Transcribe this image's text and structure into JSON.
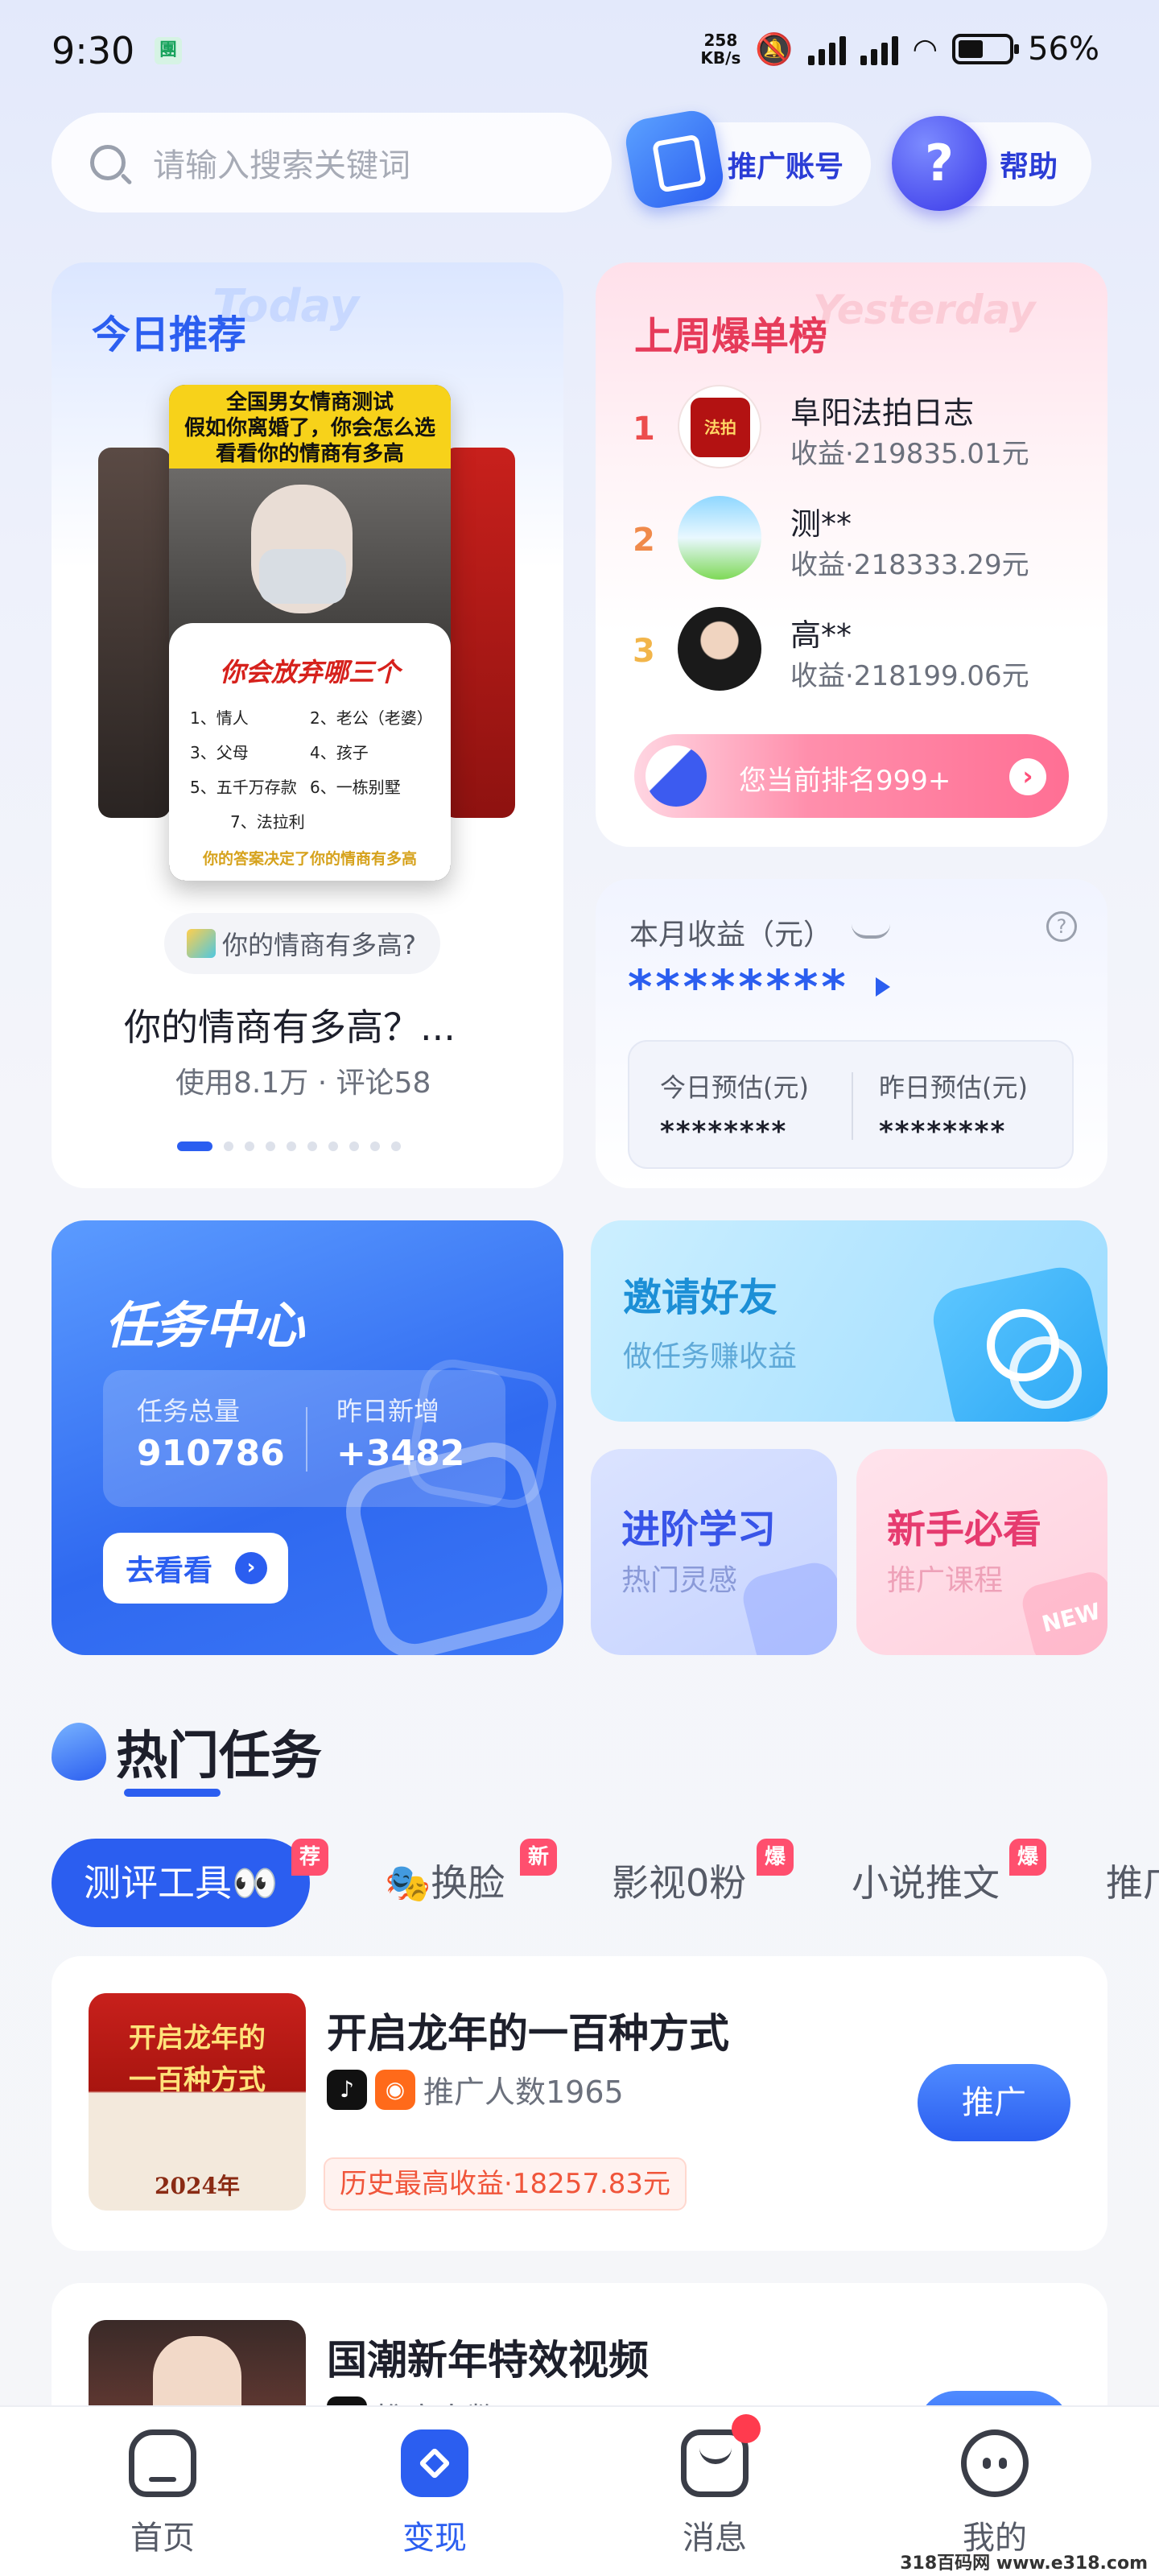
{
  "status_bar": {
    "time": "9:30",
    "app_badge": "團",
    "speed_top": "258",
    "speed_bottom": "KB/s",
    "battery": "56%"
  },
  "header": {
    "search_placeholder": "请输入搜索关键词",
    "promo_account": "推广账号",
    "help": "帮助"
  },
  "today": {
    "title": "今日推荐",
    "ghost": "Today",
    "poster_top": "全国男女情商测试\n假如你离婚了，你会怎么选\n看看你的情商有多高",
    "poster_question": "你会放弃哪三个",
    "poster_items": [
      "1、情人",
      "2、老公（老婆）",
      "3、父母",
      "4、孩子",
      "5、五千万存款",
      "6、一栋别墅",
      "7、法拉利",
      ""
    ],
    "poster_foot": "你的答案决定了你的情商有多高",
    "tag": "你的情商有多高?",
    "name": "你的情商有多高？...",
    "meta": "使用8.1万 · 评论58"
  },
  "weekly": {
    "title": "上周爆单榜",
    "ghost": "Yesterday",
    "ranks": [
      {
        "num": "1",
        "name": "阜阳法拍日志",
        "earn": "收益·219835.01元",
        "color": "#ec4d4d"
      },
      {
        "num": "2",
        "name": "测**",
        "earn": "收益·218333.29元",
        "color": "#f08a4b"
      },
      {
        "num": "3",
        "name": "高**",
        "earn": "收益·218199.06元",
        "color": "#f2b54a"
      }
    ],
    "my_rank": "您当前排名999+"
  },
  "monthly": {
    "label": "本月收益（元）",
    "value": "********",
    "today_label": "今日预估(元)",
    "today_value": "********",
    "yesterday_label": "昨日预估(元)",
    "yesterday_value": "********"
  },
  "task_center": {
    "title": "任务中心",
    "total_label": "任务总量",
    "total_value": "910786",
    "new_label": "昨日新增",
    "new_value": "+3482",
    "go": "去看看"
  },
  "invite": {
    "title": "邀请好友",
    "sub": "做任务赚收益"
  },
  "learn": {
    "title": "进阶学习",
    "sub": "热门灵感"
  },
  "newbie": {
    "title": "新手必看",
    "sub": "推广课程",
    "deco": "NEW"
  },
  "hot": {
    "title": "热门任务",
    "tabs": [
      {
        "label": "测评工具👀",
        "badge": "荐"
      },
      {
        "label": "🎭换脸",
        "badge": "新"
      },
      {
        "label": "影视0粉",
        "badge": "爆"
      },
      {
        "label": "小说推文",
        "badge": "爆"
      },
      {
        "label": "推广",
        "badge": ""
      }
    ]
  },
  "items": [
    {
      "title": "开启龙年的一百种方式",
      "promoters": "推广人数1965",
      "earn": "历史最高收益·18257.83元",
      "button": "推广",
      "thumb_text": "开启龙年的\n一百种方式",
      "thumb_year": "2024年"
    },
    {
      "title": "国潮新年特效视频",
      "promoters": "推广人数",
      "earn": "",
      "button": "推广"
    }
  ],
  "nav": [
    {
      "label": "首页"
    },
    {
      "label": "变现"
    },
    {
      "label": "消息"
    },
    {
      "label": "我的"
    }
  ],
  "watermark": "318百码网 www.e318.com",
  "colors": {
    "accent": "#2b5ef0",
    "hot_red": "#e63b5a",
    "badge": "#ff4f6e"
  }
}
